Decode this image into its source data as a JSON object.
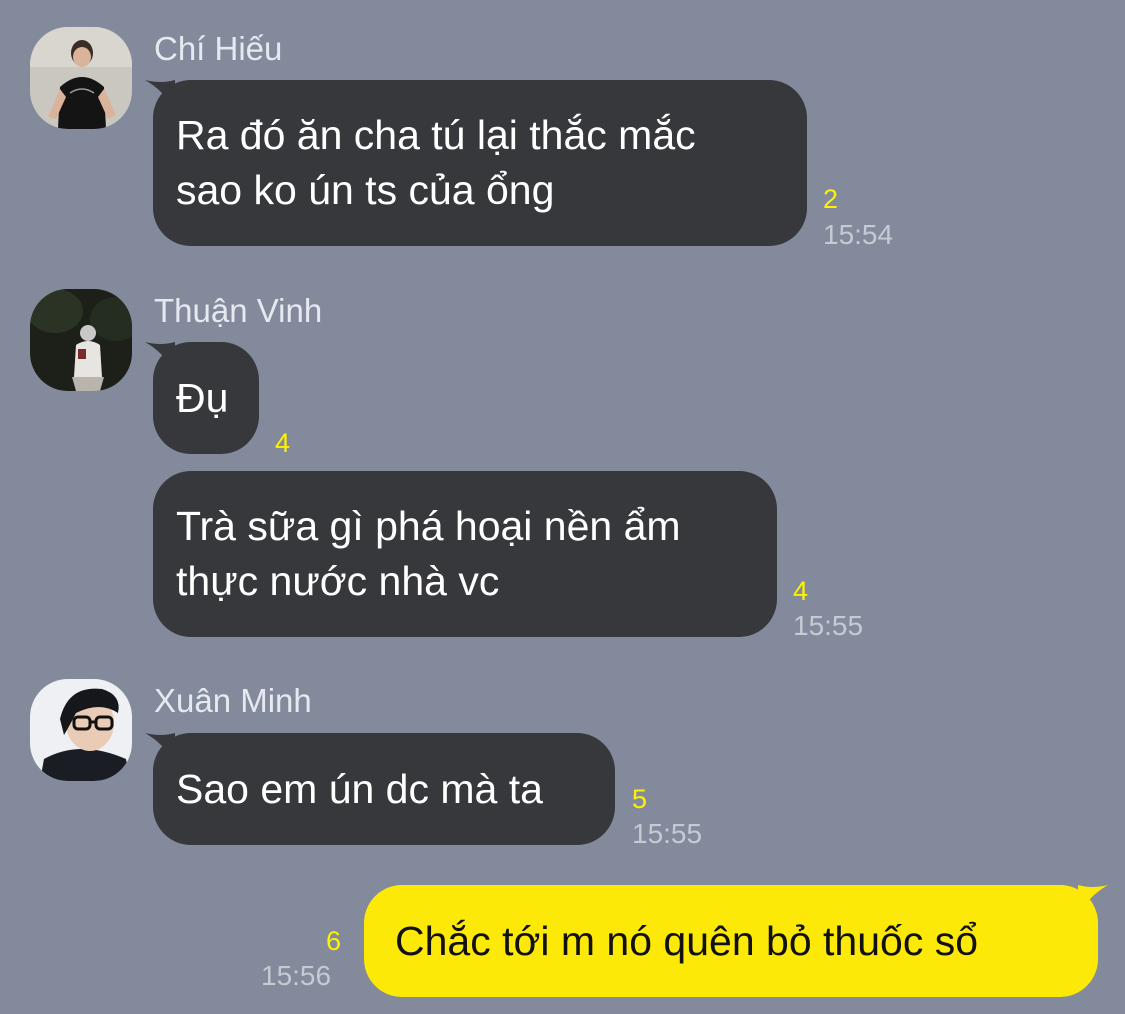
{
  "messages": [
    {
      "sender": "Chí Hiếu",
      "avatar": "avatar-chi-hieu",
      "bubbles": [
        {
          "lines": [
            "Ra đó ăn cha tú lại thắc mắc",
            "sao ko ún ts của ổng"
          ],
          "unread": "2",
          "time": "15:54"
        }
      ]
    },
    {
      "sender": "Thuận Vinh",
      "avatar": "avatar-thuan-vinh",
      "bubbles": [
        {
          "lines": [
            "Đụ"
          ],
          "unread": "4",
          "time": ""
        },
        {
          "lines": [
            "Trà sữa gì phá hoại nền ẩm",
            "thực nước nhà vc"
          ],
          "unread": "4",
          "time": "15:55"
        }
      ]
    },
    {
      "sender": "Xuân Minh",
      "avatar": "avatar-xuan-minh",
      "bubbles": [
        {
          "lines": [
            "Sao em ún dc mà ta"
          ],
          "unread": "5",
          "time": "15:55"
        }
      ]
    },
    {
      "sender": "",
      "avatar": "",
      "outgoing": true,
      "bubbles": [
        {
          "lines": [
            "Chắc tới m nó quên bỏ thuốc sổ"
          ],
          "unread": "6",
          "time": "15:56"
        }
      ]
    }
  ],
  "colors": {
    "background": "#828a9c",
    "incoming_bubble": "#37383c",
    "outgoing_bubble": "#fde908",
    "unread": "#fff100",
    "time": "#c5cad3"
  }
}
